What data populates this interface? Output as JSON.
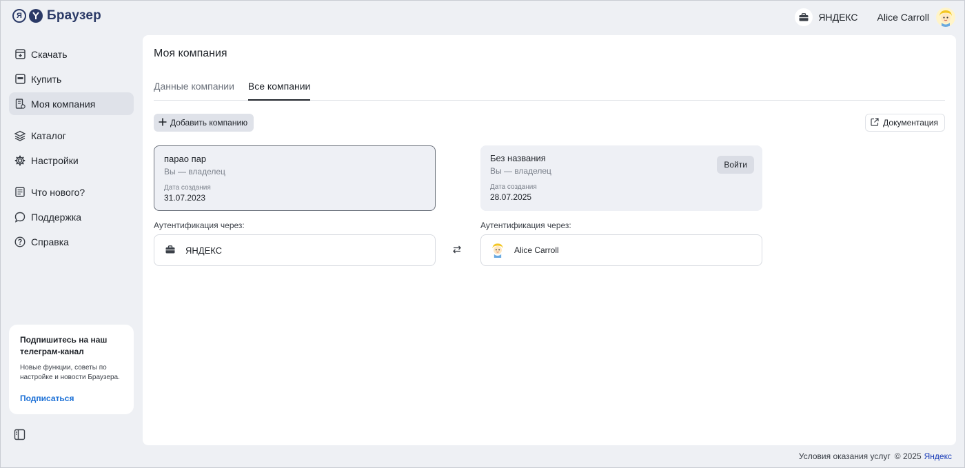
{
  "header": {
    "logo_text": "Браузер",
    "logo_ya": "Я",
    "org_name": "ЯНДЕКС",
    "user_name": "Alice Carroll"
  },
  "sidebar": {
    "items": [
      {
        "label": "Скачать",
        "icon": "download-icon"
      },
      {
        "label": "Купить",
        "icon": "wallet-icon"
      },
      {
        "label": "Моя компания",
        "icon": "company-icon",
        "active": true
      },
      {
        "label": "Каталог",
        "icon": "layers-icon"
      },
      {
        "label": "Настройки",
        "icon": "gear-icon"
      },
      {
        "label": "Что нового?",
        "icon": "news-icon"
      },
      {
        "label": "Поддержка",
        "icon": "chat-icon"
      },
      {
        "label": "Справка",
        "icon": "help-icon"
      }
    ],
    "promo": {
      "title": "Подпишитесь на наш телеграм-канал",
      "text": "Новые функции, советы по настройке и новости Браузера.",
      "link": "Подписаться"
    }
  },
  "main": {
    "title": "Моя компания",
    "tabs": [
      {
        "label": "Данные компании",
        "active": false
      },
      {
        "label": "Все компании",
        "active": true
      }
    ],
    "add_button": "Добавить компанию",
    "doc_button": "Документация",
    "companies": [
      {
        "name": "парао пар",
        "role": "Вы — владелец",
        "date_label": "Дата создания",
        "date": "31.07.2023",
        "auth_label": "Аутентификация через:",
        "auth_name": "ЯНДЕКС"
      },
      {
        "name": "Без названия",
        "role": "Вы — владелец",
        "date_label": "Дата создания",
        "date": "28.07.2025",
        "login_button": "Войти",
        "auth_label": "Аутентификация через:",
        "auth_name": "Alice Carroll"
      }
    ]
  },
  "footer": {
    "terms": "Условия оказания услуг",
    "copyright": "© 2025",
    "brand": "Яндекс"
  },
  "colors": {
    "background": "#eef0f4",
    "panel": "#ffffff",
    "brand": "#2b3a67",
    "link": "#1a6fd6",
    "active_nav": "#dfe2e9"
  }
}
